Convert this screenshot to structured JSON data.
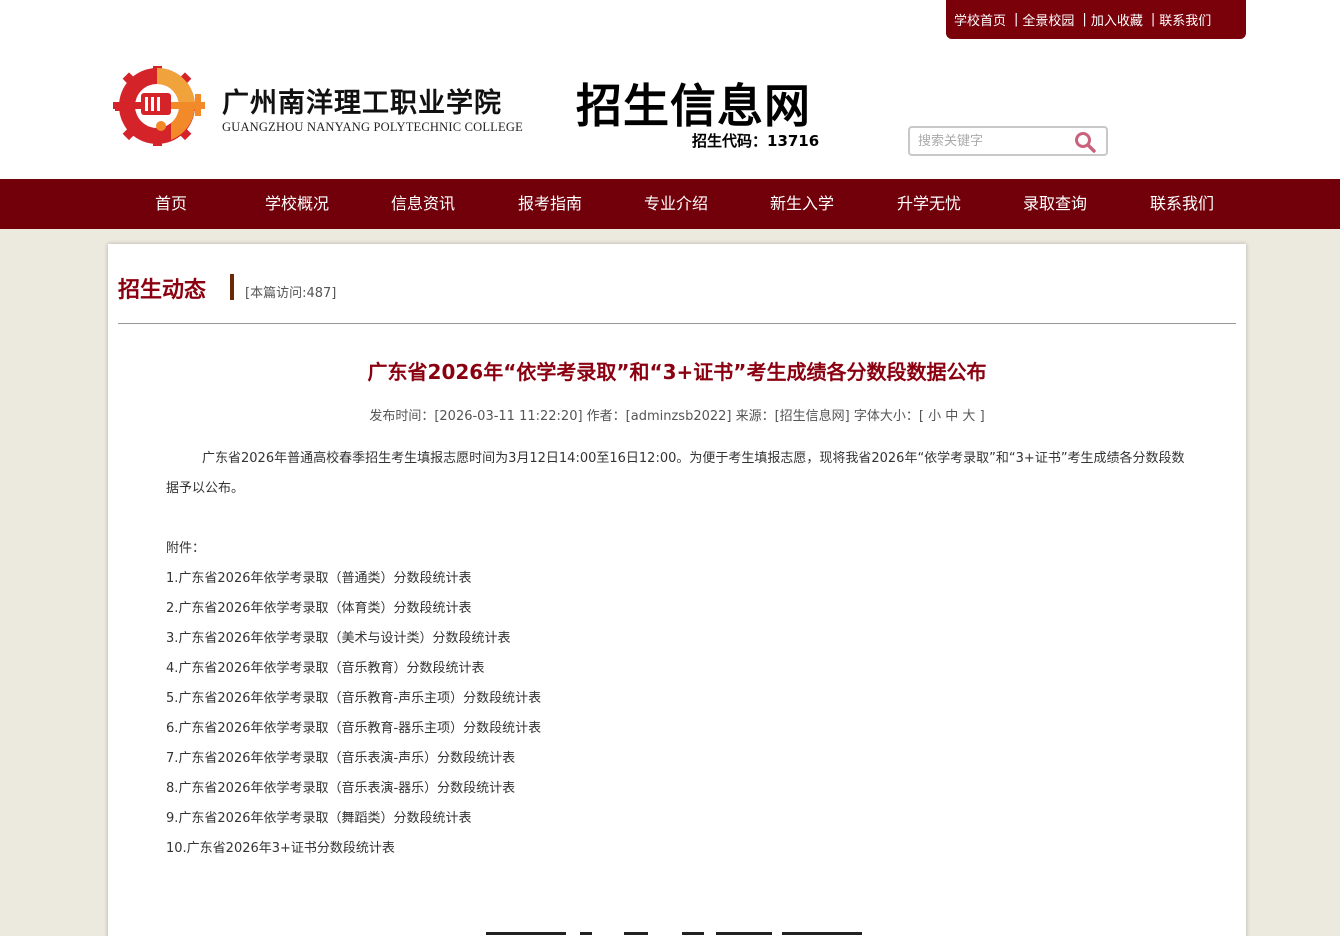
{
  "toplinks": [
    "学校首页",
    "全景校园",
    "加入收藏",
    "联系我们"
  ],
  "logo": {
    "name_cn": "广州南洋理工职业学院",
    "name_en": "GUANGZHOU NANYANG POLYTECHNIC COLLEGE"
  },
  "site": {
    "title": "招生信息网",
    "code": "招生代码：13716"
  },
  "search": {
    "placeholder": "搜索关键字"
  },
  "nav": [
    "首页",
    "学校概况",
    "信息资讯",
    "报考指南",
    "专业介绍",
    "新生入学",
    "升学无忧",
    "录取查询",
    "联系我们"
  ],
  "section": {
    "title": "招生动态",
    "visits": "[本篇访问:487]"
  },
  "article": {
    "title": "广东省2026年“依学考录取”和“3+证书”考生成绩各分数段数据公布",
    "meta": "发布时间：[2026-03-11 11:22:20] 作者：[adminzsb2022] 来源：[招生信息网] 字体大小：",
    "font_sizes": [
      "[",
      "小",
      "中",
      "大",
      "]"
    ],
    "para": "广东省2026年普通高校春季招生考生填报志愿时间为3月12日14:00至16日12:00。为便于考生填报志愿，现将我省2026年“依学考录取”和“3+证书”考生成绩各分数段数据予以公布。",
    "attach_label": "附件：",
    "attachments": [
      "1.广东省2026年依学考录取（普通类）分数段统计表",
      "2.广东省2026年依学考录取（体育类）分数段统计表",
      "3.广东省2026年依学考录取（美术与设计类）分数段统计表",
      "4.广东省2026年依学考录取（音乐教育）分数段统计表",
      "5.广东省2026年依学考录取（音乐教育-声乐主项）分数段统计表",
      "6.广东省2026年依学考录取（音乐教育-器乐主项）分数段统计表",
      "7.广东省2026年依学考录取（音乐表演-声乐）分数段统计表",
      "8.广东省2026年依学考录取（音乐表演-器乐）分数段统计表",
      "9.广东省2026年依学考录取（舞蹈类）分数段统计表",
      "10.广东省2026年3+证书分数段统计表"
    ]
  },
  "colors": {
    "brand": "#72000a",
    "title": "#8b0010",
    "bg": "#ece9df"
  }
}
